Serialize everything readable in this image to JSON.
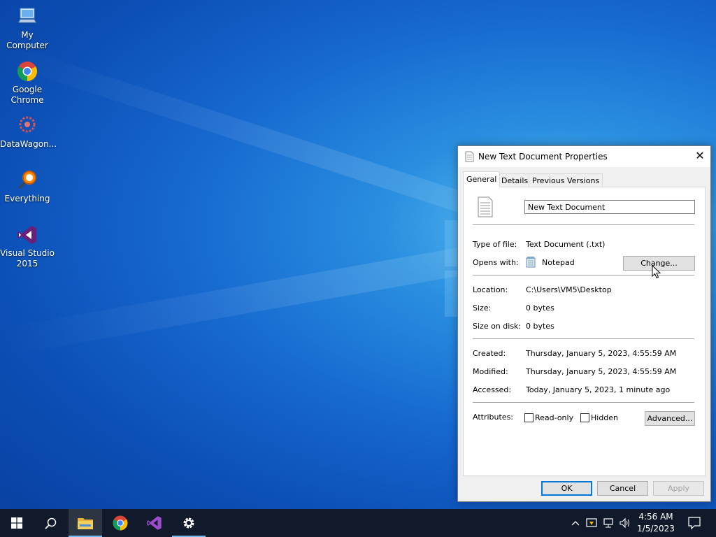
{
  "desktop": {
    "icons": [
      {
        "label": "My Computer",
        "icon": "computer-icon"
      },
      {
        "label": "Google Chrome",
        "icon": "chrome-icon"
      },
      {
        "label": "DataWagon...",
        "icon": "datawagon-icon"
      },
      {
        "label": "Everything",
        "icon": "everything-search-icon"
      },
      {
        "label": "Visual Studio 2015",
        "icon": "visual-studio-icon"
      }
    ]
  },
  "dialog": {
    "title": "New Text Document Properties",
    "tabs": [
      {
        "label": "General",
        "active": true
      },
      {
        "label": "Details",
        "active": false
      },
      {
        "label": "Previous Versions",
        "active": false
      }
    ],
    "file_name": "New Text Document",
    "type_label": "Type of file:",
    "type_value": "Text Document (.txt)",
    "opens_label": "Opens with:",
    "opens_value": "Notepad",
    "change_button": "Change...",
    "location_label": "Location:",
    "location_value": "C:\\Users\\VM5\\Desktop",
    "size_label": "Size:",
    "size_value": "0 bytes",
    "size_disk_label": "Size on disk:",
    "size_disk_value": "0 bytes",
    "created_label": "Created:",
    "created_value": "Thursday, January 5, 2023, 4:55:59 AM",
    "modified_label": "Modified:",
    "modified_value": "Thursday, January 5, 2023, 4:55:59 AM",
    "accessed_label": "Accessed:",
    "accessed_value": "Today, January 5, 2023, 1 minute ago",
    "attributes_label": "Attributes:",
    "readonly_label": "Read-only",
    "readonly_checked": false,
    "hidden_label": "Hidden",
    "hidden_checked": false,
    "advanced_button": "Advanced...",
    "ok_button": "OK",
    "cancel_button": "Cancel",
    "apply_button": "Apply"
  },
  "taskbar": {
    "items": [
      "start-icon",
      "search-icon",
      "file-explorer-icon",
      "chrome-icon",
      "visual-studio-icon",
      "settings-icon"
    ],
    "active_item": "file-explorer-icon",
    "tray_icons": [
      "chevron-up-icon",
      "security-icon",
      "network-icon",
      "volume-icon"
    ],
    "time": "4:56 AM",
    "date": "1/5/2023",
    "notification_icon": "action-center-icon"
  },
  "colors": {
    "accent": "#0078d7",
    "taskbar": "#101a2a",
    "desktop": "#1668cf"
  }
}
